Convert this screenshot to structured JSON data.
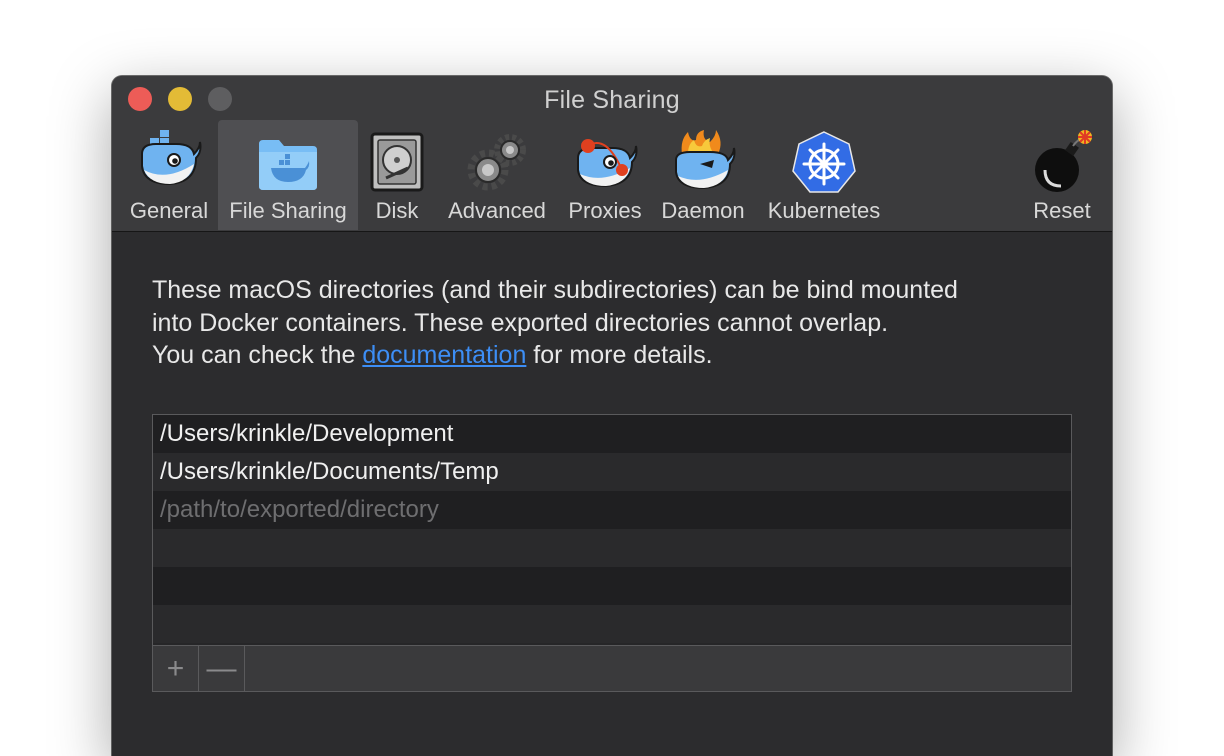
{
  "window": {
    "title": "File Sharing"
  },
  "toolbar": {
    "tabs": [
      {
        "label": "General",
        "icon": "docker-whale-icon"
      },
      {
        "label": "File Sharing",
        "icon": "folder-icon"
      },
      {
        "label": "Disk",
        "icon": "hard-disk-icon"
      },
      {
        "label": "Advanced",
        "icon": "gears-icon"
      },
      {
        "label": "Proxies",
        "icon": "proxy-whale-icon"
      },
      {
        "label": "Daemon",
        "icon": "daemon-whale-icon"
      },
      {
        "label": "Kubernetes",
        "icon": "kubernetes-icon"
      },
      {
        "label": "Reset",
        "icon": "bomb-icon"
      }
    ],
    "active_tab": "File Sharing"
  },
  "description": {
    "line1": "These macOS directories (and their subdirectories) can be bind mounted",
    "line2": "into Docker containers. These exported directories cannot overlap.",
    "line3_prefix": "You can check the ",
    "link_text": "documentation",
    "line3_suffix": " for more details."
  },
  "directories": {
    "items": [
      "/Users/krinkle/Development",
      "/Users/krinkle/Documents/Temp"
    ],
    "placeholder": "/path/to/exported/directory"
  },
  "list_footer": {
    "add_label": "+",
    "remove_label": "—"
  },
  "colors": {
    "accent_link": "#3d8ef5",
    "close": "#ed5c57",
    "minimize": "#e3bb36",
    "zoom": "#5e5e60",
    "whale_blue": "#6fb3f0",
    "kubernetes_blue": "#326ce5"
  }
}
